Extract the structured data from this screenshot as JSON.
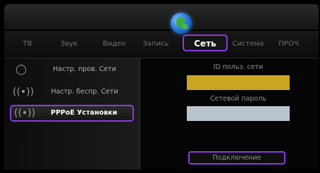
{
  "tabs": [
    {
      "label": "ТВ"
    },
    {
      "label": "Звук"
    },
    {
      "label": "Видео"
    },
    {
      "label": "Запись"
    },
    {
      "label": "Сеть"
    },
    {
      "label": "Система"
    },
    {
      "label": "ПРОЧ."
    }
  ],
  "active_tab": "Сеть",
  "active_tab_icon": "globe-icon",
  "menu": {
    "items": [
      {
        "label": "Настр. пров. Сети",
        "icon": "wired-network-icon"
      },
      {
        "label": "Настр. беспр. Сети",
        "icon": "wireless-network-icon"
      },
      {
        "label": "PPPoE Установки",
        "icon": "pppoe-signal-icon"
      }
    ],
    "selected": "PPPoE Установки"
  },
  "form": {
    "user_id_label": "ID польз. сети",
    "user_id_value": "",
    "password_label": "Сетевой пароль",
    "password_value": "",
    "connect_label": "Подключение"
  },
  "colors": {
    "highlight": "#8a3be0",
    "user_id_field": "#c9a520",
    "password_field": "#b9c4cf"
  }
}
